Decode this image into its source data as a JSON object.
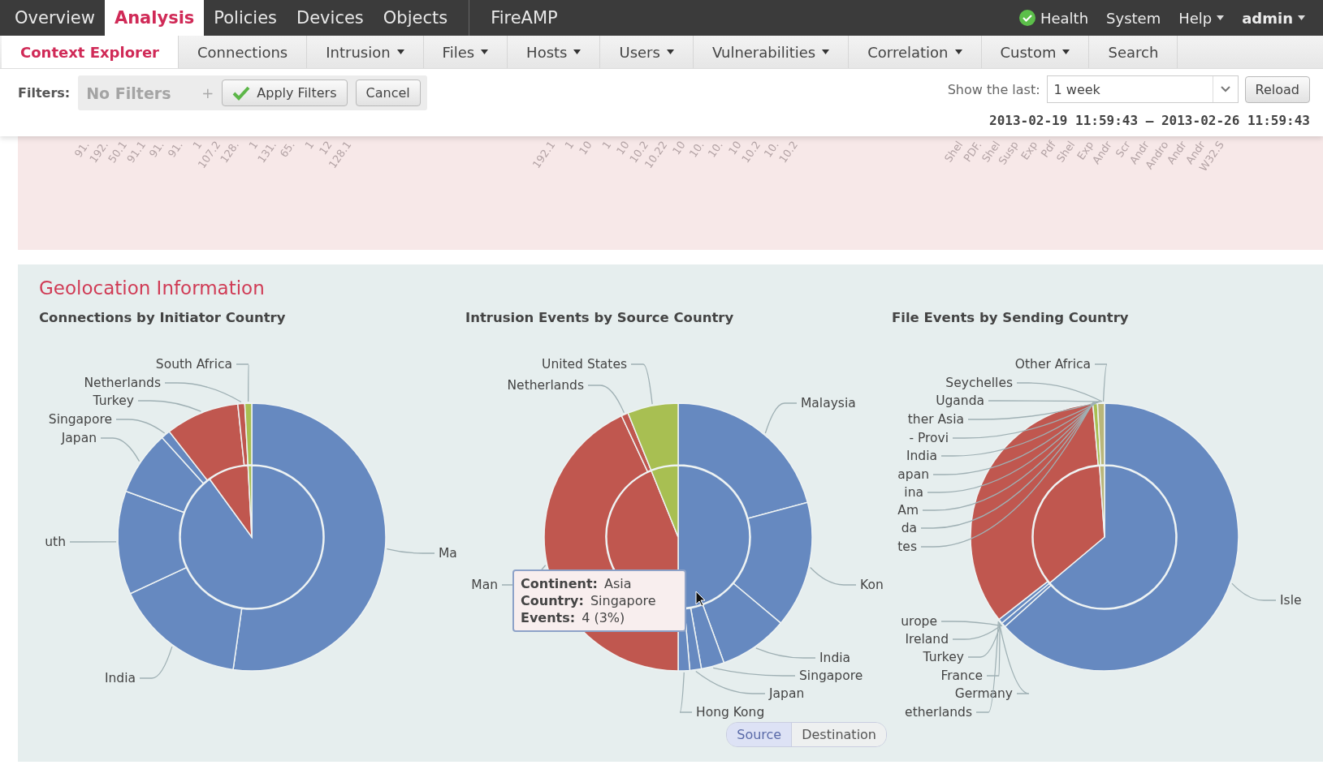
{
  "top_nav": {
    "items": [
      {
        "label": "Overview",
        "selected": false
      },
      {
        "label": "Analysis",
        "selected": true
      },
      {
        "label": "Policies",
        "selected": false
      },
      {
        "label": "Devices",
        "selected": false
      },
      {
        "label": "Objects",
        "selected": false
      },
      {
        "label": "FireAMP",
        "selected": false
      }
    ],
    "right": [
      {
        "label": "Health",
        "kind": "health"
      },
      {
        "label": "System",
        "kind": "plain"
      },
      {
        "label": "Help",
        "kind": "menu"
      },
      {
        "label": "admin",
        "kind": "user"
      }
    ]
  },
  "sub_nav": [
    {
      "label": "Context Explorer",
      "selected": true,
      "menu": false
    },
    {
      "label": "Connections",
      "selected": false,
      "menu": false
    },
    {
      "label": "Intrusion",
      "selected": false,
      "menu": true
    },
    {
      "label": "Files",
      "selected": false,
      "menu": true
    },
    {
      "label": "Hosts",
      "selected": false,
      "menu": true
    },
    {
      "label": "Users",
      "selected": false,
      "menu": true
    },
    {
      "label": "Vulnerabilities",
      "selected": false,
      "menu": true
    },
    {
      "label": "Correlation",
      "selected": false,
      "menu": true
    },
    {
      "label": "Custom",
      "selected": false,
      "menu": true
    },
    {
      "label": "Search",
      "selected": false,
      "menu": false
    }
  ],
  "filters": {
    "label": "Filters:",
    "placeholder": "No Filters",
    "add": "+",
    "apply": "Apply Filters",
    "cancel": "Cancel"
  },
  "time": {
    "label": "Show the last:",
    "value": "1 week",
    "reload": "Reload",
    "range": "2013-02-19 11:59:43 – 2013-02-26 11:59:43"
  },
  "axis_labels": [
    [
      "91.",
      "192.",
      "50.1",
      "91.1",
      "91.",
      "91.",
      "1",
      "107.2",
      "128.",
      "1",
      "131.",
      "65.",
      "1",
      "12",
      "128.1"
    ],
    [
      "192.1",
      "1",
      "10",
      "1",
      "10",
      "10.2",
      "10.22",
      "10",
      "10.",
      "10.",
      "10",
      "10.2",
      "10.",
      "10.2"
    ],
    [
      "Shel",
      "PDF.",
      "Shel",
      "Susp",
      "Exp",
      "Pdf",
      "Shel",
      "Exp",
      "Andr",
      "Scr",
      "Andr",
      "Andro",
      "Andr",
      "Andr",
      "W32.S"
    ]
  ],
  "geolocation": {
    "title": "Geolocation Information",
    "charts": [
      {
        "title": "Connections by Initiator Country",
        "labels": [
          "South Africa",
          "Netherlands",
          "Turkey",
          "Singapore",
          "Japan",
          "uth",
          "India",
          "Ma"
        ]
      },
      {
        "title": "Intrusion Events by Source Country",
        "labels": [
          "United States",
          "Netherlands",
          "Malaysia",
          "Kon",
          "Man",
          "India",
          "Singapore",
          "Japan",
          "Hong Kong"
        ],
        "tooltip": [
          {
            "label": "Continent:",
            "value": "Asia"
          },
          {
            "label": "Country:",
            "value": "Singapore"
          },
          {
            "label": "Events:",
            "value": "4 (3%)"
          }
        ],
        "toggle": [
          {
            "label": "Source",
            "selected": true
          },
          {
            "label": "Destination",
            "selected": false
          }
        ]
      },
      {
        "title": "File Events by Sending Country",
        "labels": [
          "Other Africa",
          "Seychelles",
          "Uganda",
          "ther Asia",
          "- Provi",
          "India",
          "apan",
          "ina",
          "Am",
          "da",
          "tes",
          "Isle",
          "urope",
          "Ireland",
          "Turkey",
          "France",
          "Germany",
          "etherlands"
        ]
      }
    ]
  }
}
